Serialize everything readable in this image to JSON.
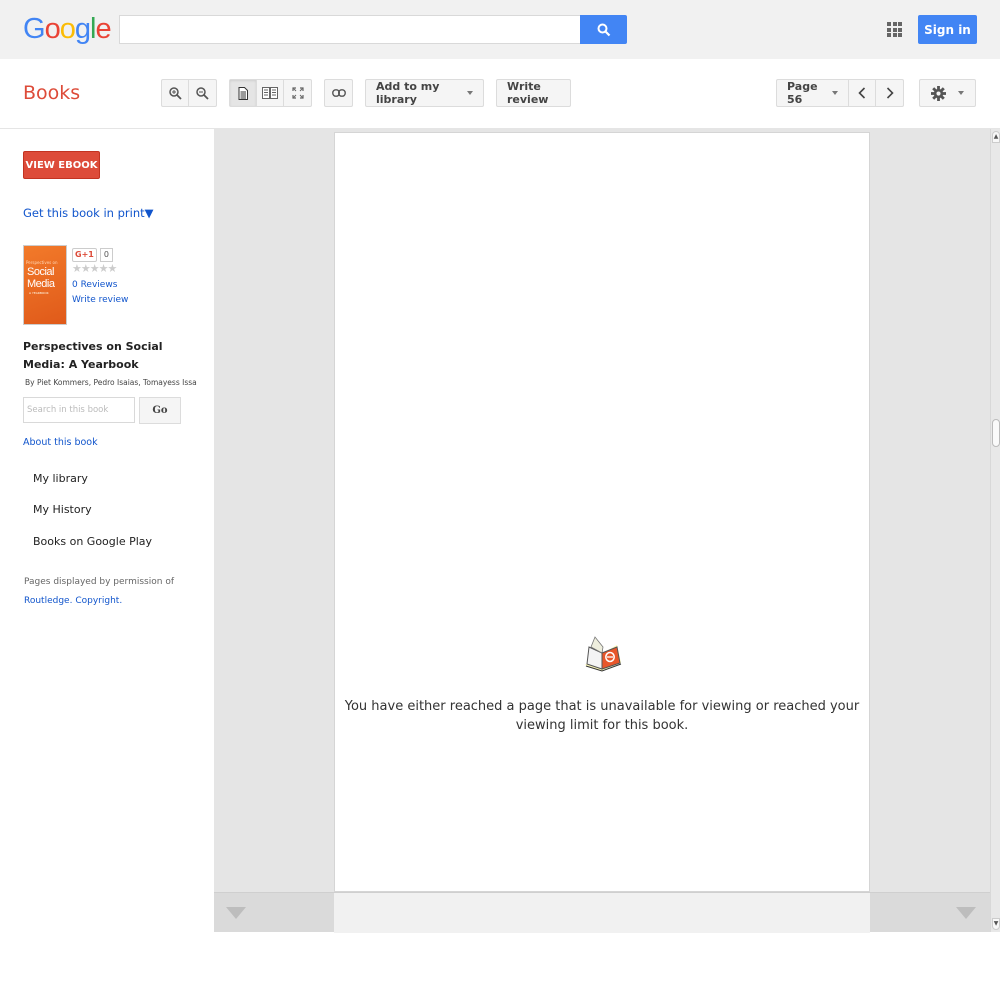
{
  "header": {
    "logo_letters": [
      {
        "ch": "G",
        "color": "#4285f4"
      },
      {
        "ch": "o",
        "color": "#ea4335"
      },
      {
        "ch": "o",
        "color": "#fbbc05"
      },
      {
        "ch": "g",
        "color": "#4285f4"
      },
      {
        "ch": "l",
        "color": "#34a853"
      },
      {
        "ch": "e",
        "color": "#ea4335"
      }
    ],
    "search_value": "",
    "search_icon": "search-icon",
    "apps_icon": "apps-grid-icon",
    "sign_in_label": "Sign in"
  },
  "toolbar": {
    "app_title": "Books",
    "zoom_in_icon": "zoom-in-icon",
    "zoom_out_icon": "zoom-out-icon",
    "single_page_icon": "single-page-icon",
    "two_page_icon": "two-page-icon",
    "fullscreen_icon": "fullscreen-icon",
    "link_icon": "link-icon",
    "add_library_label": "Add to my library",
    "write_review_label": "Write review",
    "page_label": "Page 56",
    "prev_icon": "chevron-left-icon",
    "next_icon": "chevron-right-icon",
    "settings_icon": "gear-icon"
  },
  "sidebar": {
    "view_ebook_label": "VIEW EBOOK",
    "get_print_label": "Get this book in print",
    "get_print_arrow": "▼",
    "cover": {
      "line1": "Perspectives on",
      "line2": "Social Media",
      "line3": "A YEARBOOK"
    },
    "gplus_label": "G+1",
    "gplus_count": "0",
    "stars": "★★★★★",
    "rating": 0,
    "reviews_label": "0 Reviews",
    "write_review_label": "Write review",
    "book_title": "Perspectives on Social Media: A Yearbook",
    "authors": "By Piet Kommers, Pedro Isaias, Tomayess Issa",
    "search_placeholder": "Search in this book",
    "go_label": "Go",
    "about_label": "About this book",
    "nav": [
      {
        "label": "My library"
      },
      {
        "label": "My History"
      },
      {
        "label": "Books on Google Play"
      }
    ],
    "permission_text": "Pages displayed by permission of",
    "publisher_link": "Routledge",
    "copyright_link": "Copyright"
  },
  "viewer": {
    "message": "You have either reached a page that is unavailable for viewing or reached your viewing limit for this book.",
    "book_icon": "open-book-icon",
    "scroll_position": 0.37
  }
}
